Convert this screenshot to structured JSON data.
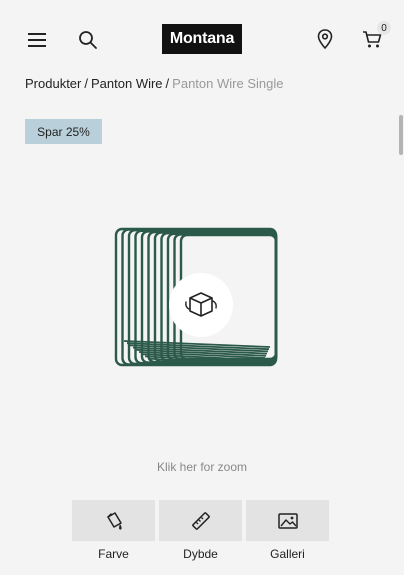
{
  "header": {
    "logo_text": "Montana",
    "cart_count": "0",
    "icons": [
      "menu-icon",
      "search-icon",
      "location-pin-icon",
      "cart-icon"
    ]
  },
  "breadcrumb": {
    "items": [
      "Produkter",
      "Panton Wire"
    ],
    "separator": "/",
    "current": "Panton Wire Single"
  },
  "badge": {
    "text": "Spar 25%",
    "color": "#b9d0da"
  },
  "product": {
    "wire_color": "#2c5a4a"
  },
  "zoom_hint": "Klik her for zoom",
  "options": [
    {
      "label": "Farve",
      "icon": "paint-bucket-icon"
    },
    {
      "label": "Dybde",
      "icon": "ruler-icon"
    },
    {
      "label": "Galleri",
      "icon": "image-icon"
    }
  ]
}
